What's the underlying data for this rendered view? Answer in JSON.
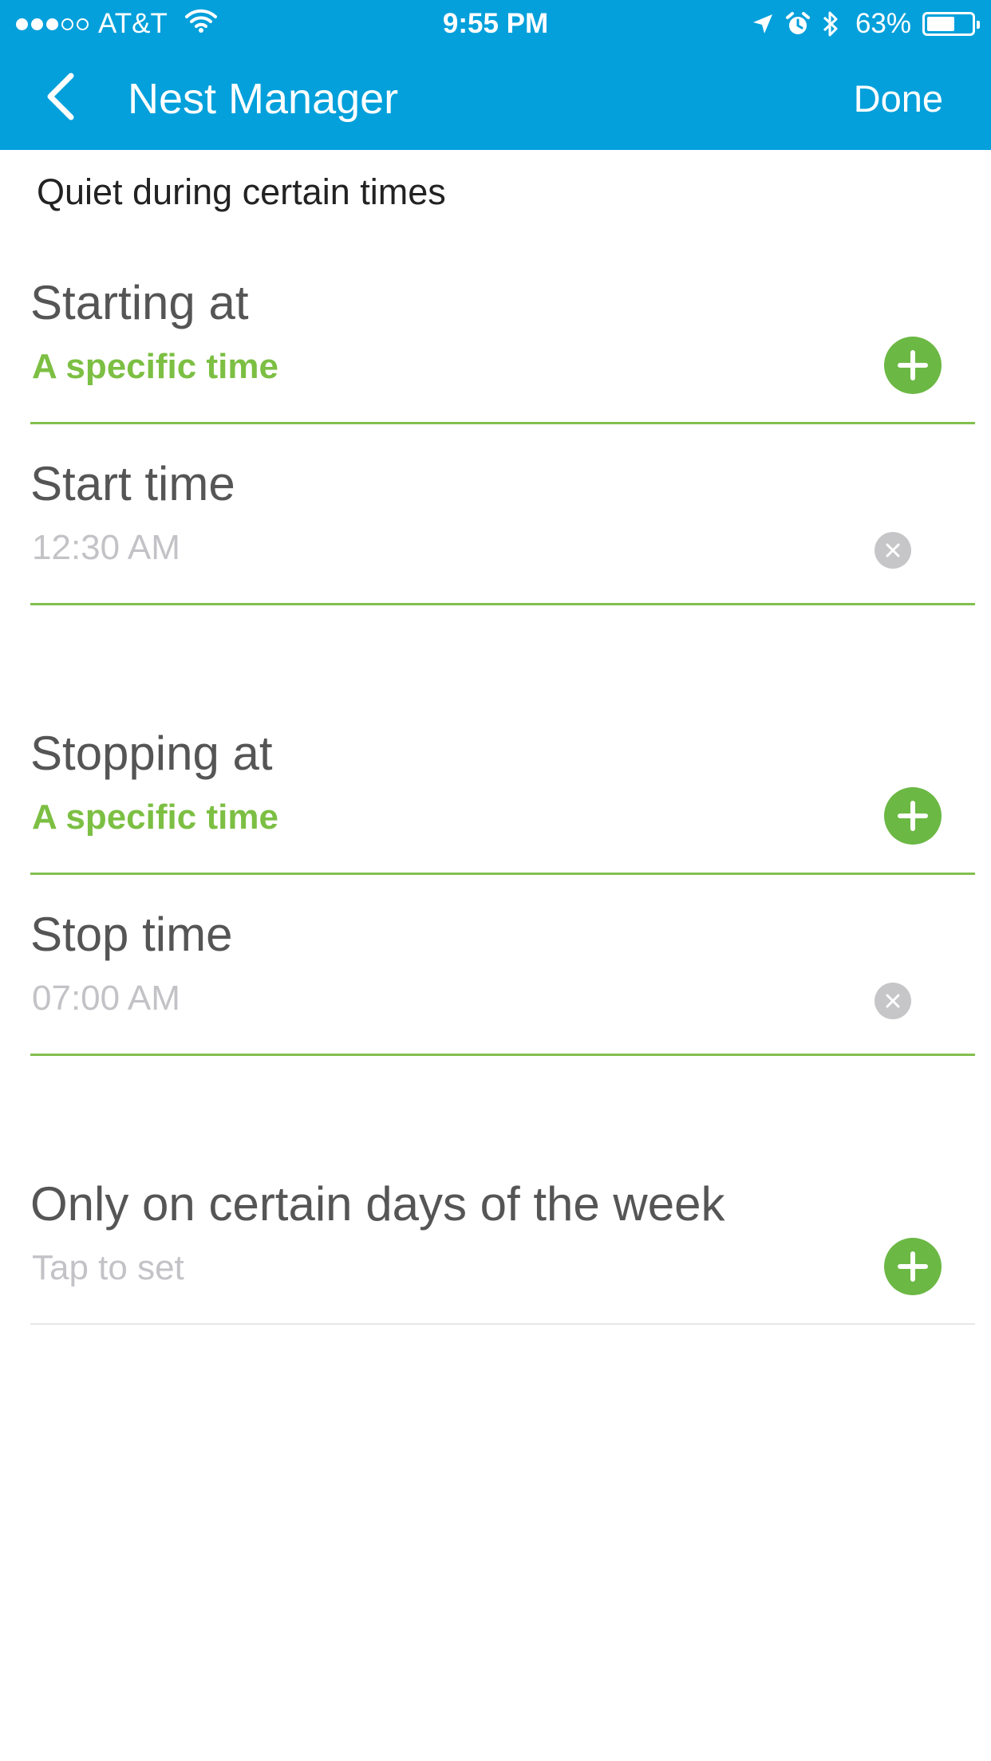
{
  "status_bar": {
    "carrier": "AT&T",
    "time": "9:55 PM",
    "battery_percent": "63%",
    "battery_level": 0.63,
    "signal_strength": 3,
    "signal_max": 5
  },
  "nav": {
    "title": "Nest Manager",
    "done_label": "Done"
  },
  "page": {
    "subtitle": "Quiet during certain times"
  },
  "rows": [
    {
      "label": "Starting at",
      "value": "A specific time"
    },
    {
      "label": "Start time",
      "value": "12:30 AM"
    },
    {
      "label": "Stopping at",
      "value": "A specific time"
    },
    {
      "label": "Stop time",
      "value": "07:00 AM"
    },
    {
      "label": "Only on certain days of the week",
      "value": "Tap to set"
    }
  ],
  "colors": {
    "header": "#03a0db",
    "accent_green": "#7cbf43",
    "add_button": "#6bb844",
    "placeholder_grey": "#c3c3c7"
  },
  "icons": {
    "back": "chevron-left-icon",
    "add": "plus-icon",
    "clear": "close-icon",
    "wifi": "wifi-icon",
    "location": "location-arrow-icon",
    "alarm": "alarm-clock-icon",
    "bluetooth": "bluetooth-icon",
    "battery": "battery-icon"
  }
}
